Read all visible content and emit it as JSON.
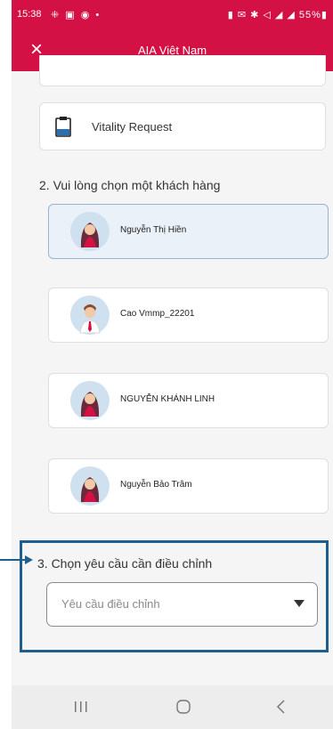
{
  "statusbar": {
    "time": "15:38",
    "left_icons": "⁜ ▣ ◉ •",
    "right_icons": "▮ ✉ ✱ ◁ ◢ ◢ 55%▮"
  },
  "appbar": {
    "title": "AIA Việt Nam",
    "close_icon": "×"
  },
  "request_option": {
    "label": "Vitality Request"
  },
  "customer_section": {
    "label": "2. Vui lòng chọn một khách hàng",
    "customers": [
      {
        "name": "Nguyễn Thị Hiền",
        "selected": true,
        "avatar": "female-avatar"
      },
      {
        "name": "Cao Vmmp_22201",
        "selected": false,
        "avatar": "male-avatar"
      },
      {
        "name": "NGUYỄN KHÁNH LINH",
        "selected": false,
        "avatar": "female-avatar"
      },
      {
        "name": "Nguyễn Bảo Trâm",
        "selected": false,
        "avatar": "female-avatar"
      }
    ]
  },
  "adjust_section": {
    "label": "3. Chọn yêu cầu cần điều chỉnh",
    "dropdown_placeholder": "Yêu cầu điều chỉnh"
  },
  "navbar": {
    "recent_icon": "|||",
    "home_icon": "○",
    "back_icon": "<"
  },
  "colors": {
    "brand": "#d31145",
    "highlight": "#1f5f8f",
    "selected_bg": "#ebf1f8"
  }
}
